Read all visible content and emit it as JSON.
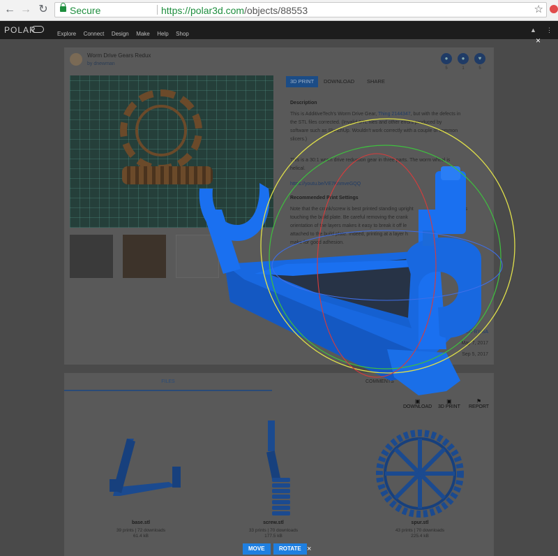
{
  "browser": {
    "secure_label": "Secure",
    "url_base": "https://polar3d.com",
    "url_path": "/objects/88553"
  },
  "site": {
    "logo": "POLAR",
    "nav": [
      "Explore",
      "Connect",
      "Design",
      "Make",
      "Help",
      "Shop"
    ]
  },
  "object": {
    "title": "Worm Drive Gears Redux",
    "by": "by dnewman",
    "counts": [
      "5",
      "1",
      "5"
    ]
  },
  "tabs": [
    "3D PRINT",
    "DOWNLOAD",
    "SHARE"
  ],
  "description": {
    "heading": "Description",
    "p1_pre": "This is AdditiveTech's Worm Drive Gear, ",
    "p1_link": "Thing 2144347",
    "p1_post": ", but with the defects in",
    "p1_line2": "the STL files corrected. (Invalid STL files and other errors produced by",
    "p1_line3": "software such as SketchUp. Wouldn't work correctly with a couple of common",
    "p1_line4": "slicers.)",
    "p2_line1": "This is a 30:1 worm drive reduction gear in three parts. The worm wheel is",
    "p2_line2": "helical.",
    "link": "https://youtu.be/VE7KnmveGQQ",
    "rec_heading": "Recommended Print Settings",
    "rec_line1": "Note that the crank/screw is best printed standing upright",
    "rec_line1b": "ts",
    "rec_line2": "touching the build plate. Be careful removing the crank",
    "rec_line2b": "; the",
    "rec_line3": "orientation of the layers makes it easy to break it off le",
    "rec_line4": "attached to the build plate. Indeed, printing at a layer h",
    "rec_line5": "make for good adhesion."
  },
  "meta": {
    "license": "CC-BY-SA",
    "created": "May 7, 2017",
    "updated": "Sep 5, 2017"
  },
  "files_section": {
    "files_tab": "FILES",
    "comments_tab": "COMMENTS",
    "actions": [
      "DOWNLOAD",
      "3D PRINT",
      "REPORT"
    ],
    "files": [
      {
        "name": "base.stl",
        "stats": "39 prints | 72 downloads",
        "size": "61.4 kB"
      },
      {
        "name": "screw.stl",
        "stats": "33 prints | 70 downloads",
        "size": "177.5 kB"
      },
      {
        "name": "spur.stl",
        "stats": "43 prints | 70 downloads",
        "size": "225.4 kB"
      }
    ]
  },
  "viewer": {
    "move_label": "MOVE",
    "rotate_label": "ROTATE",
    "close_glyph": "×"
  },
  "colors": {
    "accent": "#1f7fe0",
    "model_blue": "#1a6fe8",
    "gizmo_yellow": "#e0e04a",
    "gizmo_green": "#3fbf3f",
    "gizmo_red": "#d93b3b",
    "gizmo_blue": "#3f6fe8"
  }
}
